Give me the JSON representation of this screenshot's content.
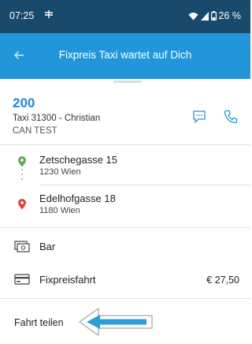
{
  "status": {
    "time": "07:25",
    "battery": "26 %"
  },
  "header": {
    "title": "Fixpreis Taxi  wartet auf Dich"
  },
  "driver": {
    "number": "200",
    "name": "Taxi 31300 - Christian",
    "company": "CAN TEST"
  },
  "route": {
    "pickup": {
      "street": "Zetschegasse 15",
      "city": "1230 Wien"
    },
    "destination": {
      "street": "Edelhofgasse 18",
      "city": "1180 Wien"
    }
  },
  "payment": {
    "label": "Bar"
  },
  "fare": {
    "label": "Fixpreisfahrt",
    "price": "€ 27,50"
  },
  "share": {
    "label": "Fahrt teilen"
  },
  "colors": {
    "statusbar": "#1a4a6b",
    "appbar": "#2196d9",
    "accent": "#1e88d6",
    "pickup": "#6aa84f",
    "destination": "#e0463b",
    "annotation_arrow": "#2a9fd8"
  }
}
